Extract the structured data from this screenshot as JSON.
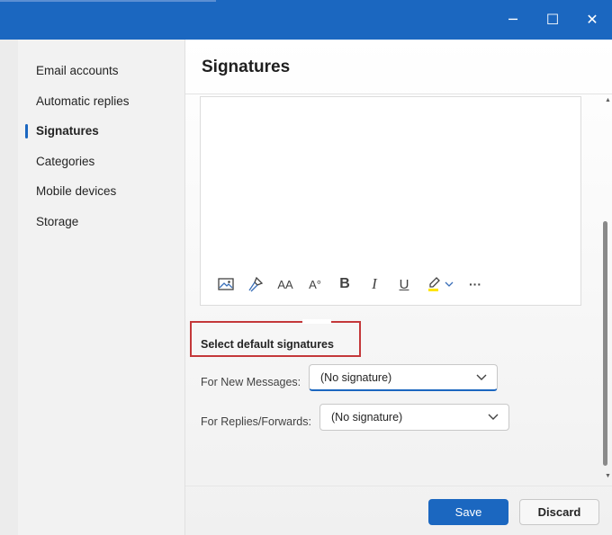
{
  "window": {
    "controls": {
      "minimize": "─",
      "maximize": "☐",
      "close": "✕"
    }
  },
  "sidebar": {
    "items": [
      {
        "label": "Email accounts",
        "active": false
      },
      {
        "label": "Automatic replies",
        "active": false
      },
      {
        "label": "Signatures",
        "active": true
      },
      {
        "label": "Categories",
        "active": false
      },
      {
        "label": "Mobile devices",
        "active": false
      },
      {
        "label": "Storage",
        "active": false
      }
    ]
  },
  "main": {
    "title": "Signatures",
    "editor": {
      "toolbar": [
        {
          "icon": "insert-image-icon",
          "glyph": ""
        },
        {
          "icon": "format-painter-icon",
          "glyph": ""
        },
        {
          "icon": "font-size-icon",
          "glyph": "AA"
        },
        {
          "icon": "superscript-icon",
          "glyph": "A°"
        },
        {
          "icon": "bold-icon",
          "glyph": "B"
        },
        {
          "icon": "italic-icon",
          "glyph": "I"
        },
        {
          "icon": "underline-icon",
          "glyph": "U"
        },
        {
          "icon": "highlight-icon",
          "glyph": ""
        },
        {
          "icon": "more-options-icon",
          "glyph": "···"
        }
      ],
      "highlight_color": "#ffe500"
    },
    "defaults": {
      "heading": "Select default signatures",
      "new_messages_label": "For New Messages:",
      "new_messages_value": "(No signature)",
      "replies_label": "For Replies/Forwards:",
      "replies_value": "(No signature)"
    },
    "buttons": {
      "save": "Save",
      "discard": "Discard"
    }
  },
  "colors": {
    "accent": "#1b67c0",
    "annotation": "#c4383a"
  }
}
